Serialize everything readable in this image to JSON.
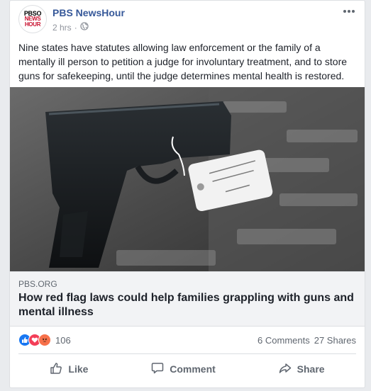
{
  "post": {
    "page_name": "PBS NewsHour",
    "avatar_text": [
      "PBSO",
      "NEWS",
      "HOUR"
    ],
    "timestamp": "2 hrs",
    "privacy_icon": "globe-icon",
    "menu_icon": "more-options-icon",
    "text": "Nine states have statutes allowing law enforcement or the family of a mentally ill person to petition a judge for involuntary treatment, and to store guns for safekeeping, until the judge determines mental health is restored."
  },
  "link": {
    "image_icon": "handgun-photo",
    "domain": "PBS.ORG",
    "headline": "How red flag laws could help families grappling with guns and mental illness"
  },
  "stats": {
    "reactions": [
      "like-reaction-icon",
      "love-reaction-icon",
      "angry-reaction-icon"
    ],
    "reaction_count": "106",
    "comments": "6 Comments",
    "shares": "27 Shares"
  },
  "actions": {
    "like": "Like",
    "comment": "Comment",
    "share": "Share"
  },
  "colors": {
    "brand_link": "#365899",
    "like_blue": "#1877f2",
    "love_red": "#f33e58",
    "angry_orange": "#f7714b"
  }
}
